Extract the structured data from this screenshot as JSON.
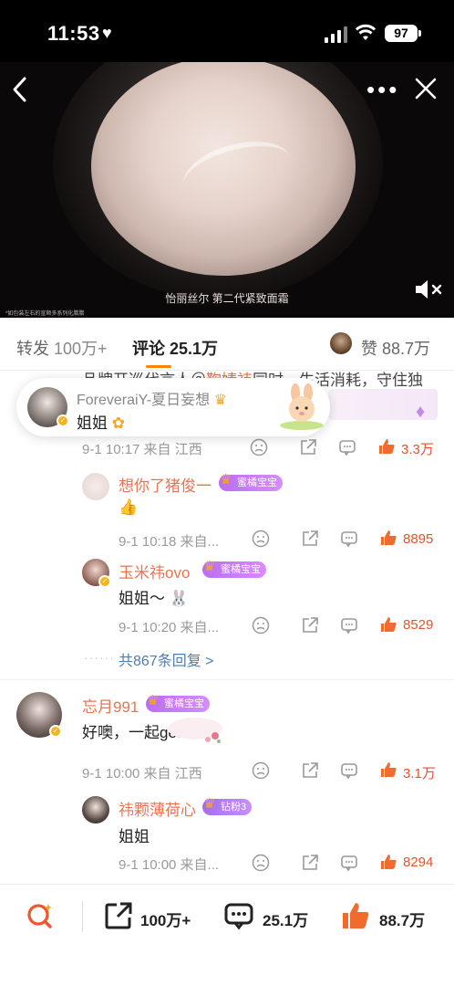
{
  "status": {
    "time": "11:53",
    "battery": "97"
  },
  "video": {
    "caption": "怡丽丝尔 第二代紧致面霜",
    "tiny_text": "*如包装左右的宣顺多系列化腊腊"
  },
  "tabs": {
    "forward_label": "转发",
    "forward_count": "100万+",
    "comment_label": "评论",
    "comment_count": "25.1万",
    "like_label": "赞",
    "like_count": "88.7万"
  },
  "partial_comment": {
    "prefix": "品牌开巡代言人＠",
    "link": "鞠婧祎",
    "suffix": "同时，生活消耗，守住独"
  },
  "popup": {
    "name": "ForeveraiY-夏日妄想",
    "text": "姐姐"
  },
  "comments": [
    {
      "meta": "9-1 10:17  来自 江西",
      "likes": "3.3万"
    },
    {
      "name": "想你了猪俊一",
      "badge": "蜜橘宝宝",
      "text": "👍",
      "meta": "9-1 10:18  来自...",
      "likes": "8895"
    },
    {
      "name": "玉米祎ovo",
      "badge": "蜜橘宝宝",
      "text": "姐姐～",
      "meta": "9-1 10:20  来自...",
      "likes": "8529"
    },
    {
      "more": "共867条回复 >"
    },
    {
      "name": "忘月991",
      "badge": "蜜橘宝宝",
      "text": "好噢，一起get",
      "meta": "9-1 10:00  来自 江西",
      "likes": "3.1万"
    },
    {
      "name": "祎颗薄荷心",
      "badge": "钻粉3",
      "text": "姐姐",
      "meta": "9-1 10:00  来自...",
      "likes": "8294"
    }
  ],
  "bottom": {
    "forward": "100万+",
    "comment": "25.1万",
    "like": "88.7万"
  },
  "colors": {
    "accent": "#ff8200",
    "name": "#eb7350",
    "like": "#e5532d",
    "link": "#507daf"
  }
}
